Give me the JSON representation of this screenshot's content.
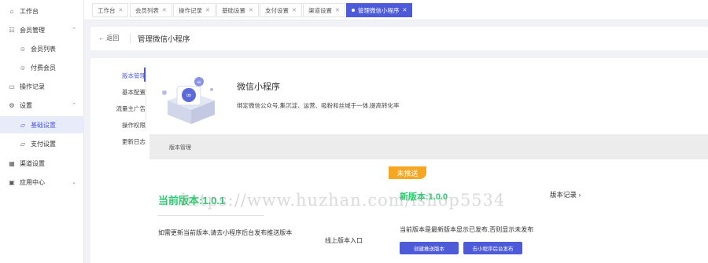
{
  "sidebar": {
    "items": [
      {
        "label": "工作台",
        "icon": "home-icon"
      },
      {
        "label": "会员管理",
        "icon": "users-icon"
      },
      {
        "label": "会员列表",
        "icon": "user-circle-icon"
      },
      {
        "label": "付费会员",
        "icon": "vip-icon"
      },
      {
        "label": "操作记录",
        "icon": "monitor-icon"
      },
      {
        "label": "设置",
        "icon": "gear-icon"
      },
      {
        "label": "基础设置",
        "icon": "folder-icon"
      },
      {
        "label": "支付设置",
        "icon": "folder-icon"
      },
      {
        "label": "渠道设置",
        "icon": "grid-icon"
      },
      {
        "label": "应用中心",
        "icon": "app-icon"
      }
    ]
  },
  "tabs": [
    {
      "label": "工作台"
    },
    {
      "label": "会员列表"
    },
    {
      "label": "操作记录"
    },
    {
      "label": "基础设置"
    },
    {
      "label": "支付设置"
    },
    {
      "label": "渠道设置"
    },
    {
      "label": "管理微信小程序"
    }
  ],
  "header": {
    "back": "← 返回",
    "title": "管理微信小程序"
  },
  "subnav": [
    "版本管理",
    "基本配置",
    "流量主广告",
    "操作权限",
    "更新日志"
  ],
  "app": {
    "name": "微信小程序",
    "desc": "绑定微信公众号,集沉淀、运营、吸粉和丝域于一体,提高转化率"
  },
  "version_bar": "版本管理",
  "current": {
    "version": "当前版本:1.0.1",
    "hint": "如需更新当前版本,请去小程序后台发布推送版本",
    "online_entry": "线上版本入口"
  },
  "new": {
    "badge": "未推送",
    "version": "新版本:1.0.0",
    "records": "版本记录 ›",
    "hint": "当前版本是最新版本显示已发布,否则显示未发布",
    "btn_push": "创建推送版本",
    "btn_backend": "去小程序后台发布"
  },
  "watermark": "https://www.huzhan.com/ishop5534"
}
